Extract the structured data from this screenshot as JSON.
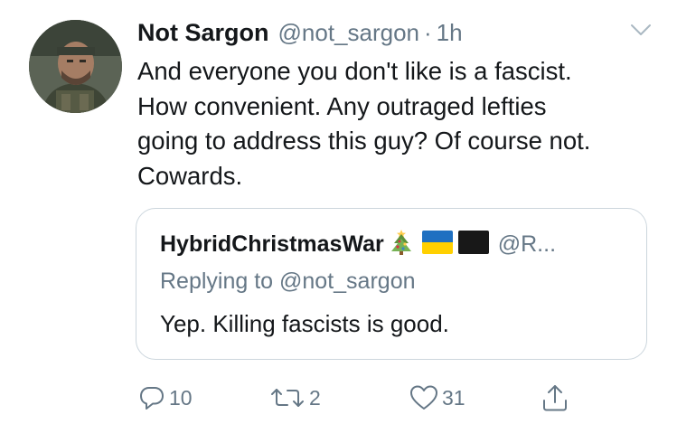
{
  "tweet": {
    "author_name": "Not Sargon",
    "author_handle": "@not_sargon",
    "separator": "·",
    "time": "1h",
    "text_lines": [
      "And everyone you don't like is a fascist.",
      "How convenient. Any outraged lefties",
      "going to address this guy? Of course not.",
      "Cowards."
    ]
  },
  "quoted": {
    "author_name": "HybridChristmasWar",
    "author_handle": "@R...",
    "replying_to": "Replying to @not_sargon",
    "text": "Yep. Killing fascists is good.",
    "emojis": [
      "christmas-tree-icon",
      "ukraine-flag-icon",
      "black-flag-icon"
    ]
  },
  "actions": {
    "reply_count": "10",
    "retweet_count": "2",
    "like_count": "31"
  },
  "colors": {
    "text": "#14171a",
    "secondary": "#657786",
    "border": "#ccd6dd"
  }
}
